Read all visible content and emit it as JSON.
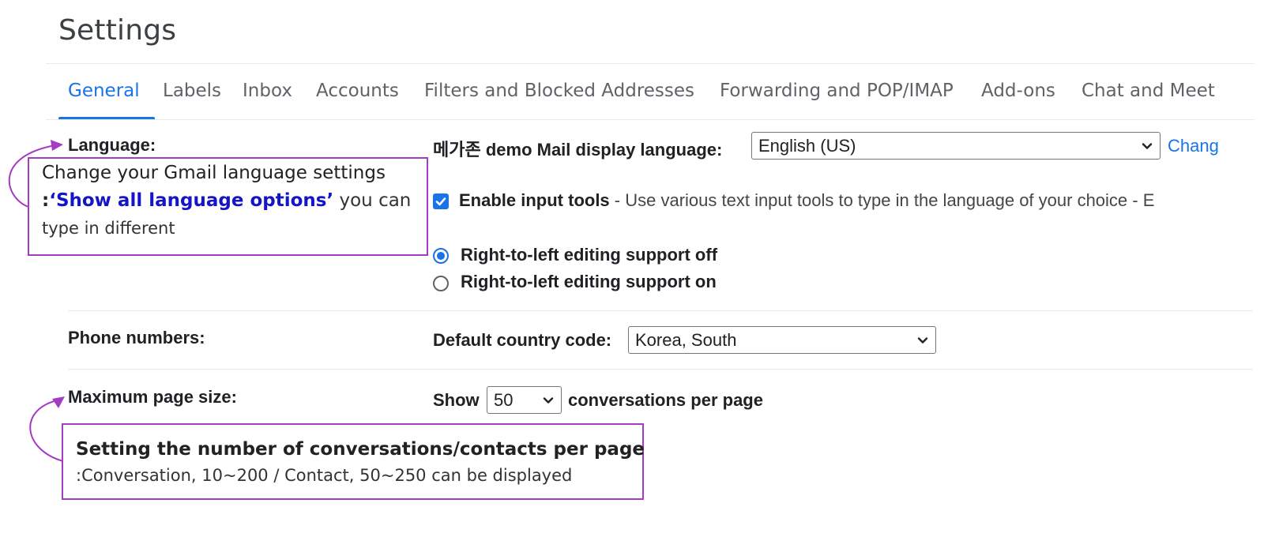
{
  "page": {
    "title": "Settings"
  },
  "tabs": [
    {
      "label": "General",
      "active": true
    },
    {
      "label": "Labels"
    },
    {
      "label": "Inbox"
    },
    {
      "label": "Accounts"
    },
    {
      "label": "Filters and Blocked Addresses"
    },
    {
      "label": "Forwarding and POP/IMAP"
    },
    {
      "label": "Add-ons"
    },
    {
      "label": "Chat and Meet"
    }
  ],
  "language": {
    "label": "Language:",
    "display_prefix": "메가존 demo Mail display language:",
    "selected": "English (US)",
    "change_link": "Chang",
    "input_tools_label": "Enable input tools",
    "input_tools_desc": " - Use various text input tools to type in the language of your choice - E",
    "input_tools_checked": true,
    "rtl_off": "Right-to-left editing support off",
    "rtl_on": "Right-to-left editing support on",
    "rtl_selected": "off"
  },
  "phone": {
    "label": "Phone numbers:",
    "country_label": "Default country code:",
    "country_selected": "Korea, South"
  },
  "page_size": {
    "label": "Maximum page size:",
    "show": "Show",
    "value": "50",
    "suffix": "conversations per page"
  },
  "callouts": {
    "language": {
      "head": "Change your Gmail language settings",
      "colon": ":",
      "highlight": "‘Show all language options’",
      "rest_line1": " you can",
      "line2": "type in different"
    },
    "page_size": {
      "head": "Setting the number of conversations/contacts per page",
      "body": ":Conversation, 10~200 / Contact, 50~250 can be displayed"
    }
  },
  "colors": {
    "accent": "#1a73e8",
    "annotation": "#a33cc2",
    "highlight": "#1515c8"
  }
}
